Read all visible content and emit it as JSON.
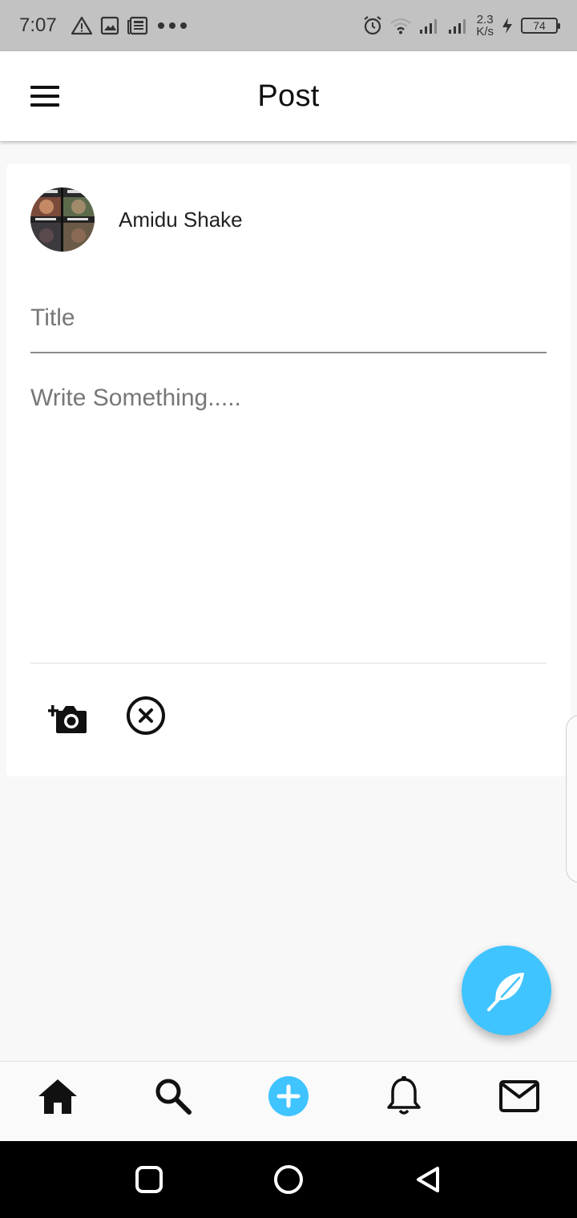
{
  "status_bar": {
    "time": "7:07",
    "speed_value": "2.3",
    "speed_unit": "K/s",
    "battery": "74",
    "left_icons": [
      "warning-icon",
      "image-icon",
      "news-icon",
      "more-dots-icon"
    ],
    "right_icons": [
      "alarm-icon",
      "wifi-icon",
      "signal-icon",
      "signal-icon",
      "charging-icon"
    ]
  },
  "app_bar": {
    "title": "Post",
    "menu_icon": "hamburger-menu-icon"
  },
  "post": {
    "author": "Amidu Shake",
    "title_placeholder": "Title",
    "title_value": "",
    "body_placeholder": "Write Something.....",
    "body_value": "",
    "actions": [
      "add-photo-icon",
      "cancel-circle-icon"
    ]
  },
  "fab": {
    "icon": "feather-icon",
    "color": "#40c4ff"
  },
  "bottom_nav": {
    "items": [
      {
        "icon": "home-icon",
        "name": "home"
      },
      {
        "icon": "search-icon",
        "name": "search"
      },
      {
        "icon": "add-circle-icon",
        "name": "add"
      },
      {
        "icon": "bell-icon",
        "name": "notifications"
      },
      {
        "icon": "mail-icon",
        "name": "messages"
      }
    ],
    "accent": "#40c4ff"
  },
  "system_nav": {
    "buttons": [
      "recents-square-icon",
      "home-circle-icon",
      "back-triangle-icon"
    ]
  }
}
